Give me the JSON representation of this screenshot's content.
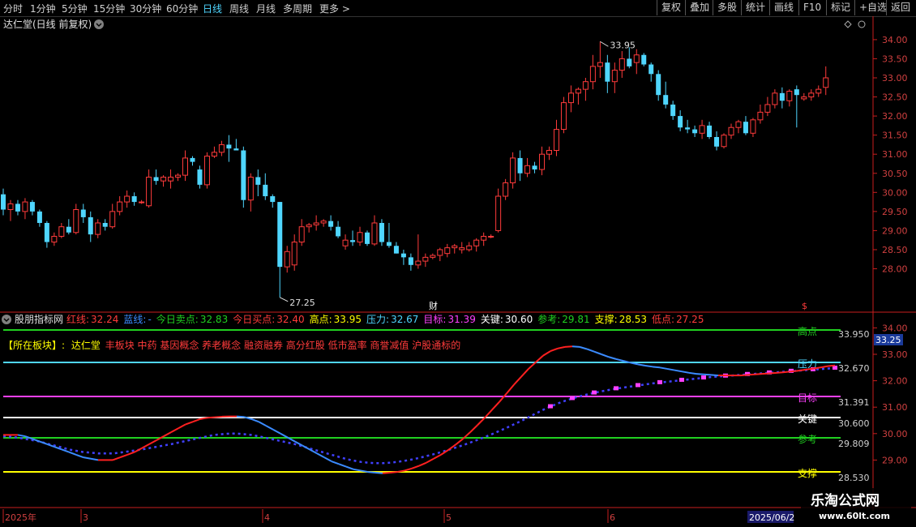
{
  "toolbar": {
    "periods": [
      "分时",
      "1分钟",
      "5分钟",
      "15分钟",
      "30分钟",
      "60分钟",
      "日线",
      "周线",
      "月线",
      "多周期",
      "更多 >"
    ],
    "active_period": "日线",
    "right_buttons": [
      "复权",
      "叠加",
      "多股",
      "统计",
      "画线",
      "F10",
      "标记",
      "+自选",
      "返回"
    ]
  },
  "stock_title": "达仁堂(日线 前复权)",
  "price_axis": [
    "34.00",
    "33.50",
    "33.00",
    "32.50",
    "32.00",
    "31.50",
    "31.00",
    "30.50",
    "30.00",
    "29.50",
    "29.00",
    "28.50",
    "28.00"
  ],
  "high_marker": "33.95",
  "low_marker": "27.25",
  "finance_badge": "财",
  "shares_badge": "$",
  "indicator_name": "股朋指标网",
  "indicator_values": [
    {
      "label": "红线:",
      "value": "32.24",
      "color": "#ff3b3b"
    },
    {
      "label": "蓝线:",
      "value": "-",
      "color": "#3b8bff"
    },
    {
      "label": "今日卖点:",
      "value": "32.83",
      "color": "#20d020"
    },
    {
      "label": "今日买点:",
      "value": "32.40",
      "color": "#ff3b3b"
    },
    {
      "label": "高点:",
      "value": "33.95",
      "color": "#ffff00"
    },
    {
      "label": "压力:",
      "value": "32.67",
      "color": "#4fd6ff"
    },
    {
      "label": "目标:",
      "value": "31.39",
      "color": "#ff40ff"
    },
    {
      "label": "关键:",
      "value": "30.60",
      "color": "#ffffff"
    },
    {
      "label": "参考:",
      "value": "29.81",
      "color": "#20d020"
    },
    {
      "label": "支撑:",
      "value": "28.53",
      "color": "#ffff00"
    },
    {
      "label": "低点:",
      "value": "27.25",
      "color": "#ff3b3b"
    }
  ],
  "sector_label": "【所在板块】:",
  "sector_stock": "达仁堂",
  "sector_tags": "丰板块 中药 基因概念 养老概念 融资融券 高分红股 低市盈率 商誉减值 沪股通标的",
  "indicator_axis": [
    "34.00",
    "33.00",
    "32.00",
    "31.00",
    "30.00",
    "29.00"
  ],
  "level_lines": [
    {
      "name": "高点",
      "value": "33.950",
      "color": "#20d020"
    },
    {
      "name": "压力",
      "value": "32.670",
      "color": "#4fd6ff"
    },
    {
      "name": "目标",
      "value": "31.391",
      "color": "#ff40ff"
    },
    {
      "name": "关键",
      "value": "30.600",
      "color": "#ffffff"
    },
    {
      "name": "参考",
      "value": "29.809",
      "color": "#20d020"
    },
    {
      "name": "支撑",
      "value": "28.530",
      "color": "#ffff00"
    }
  ],
  "current_price_badge": "33.25",
  "date_axis": [
    "2025年",
    "3",
    "4",
    "5",
    "6"
  ],
  "date_cursor": "2025/06/2",
  "watermark": {
    "title": "乐淘公式网",
    "url": "www.60lt.com"
  },
  "colors": {
    "up": "#ff3b3b",
    "down": "#4fd6ff",
    "background": "#000000",
    "axis": "#c81e1e"
  },
  "chart_data": {
    "type": "candlestick",
    "title": "达仁堂(日线 前复权)",
    "candles": [
      [
        29.95,
        30.1,
        29.4,
        29.55
      ],
      [
        29.55,
        29.8,
        29.25,
        29.7
      ],
      [
        29.7,
        29.8,
        29.4,
        29.5
      ],
      [
        29.5,
        29.85,
        29.3,
        29.75
      ],
      [
        29.75,
        29.8,
        29.4,
        29.5
      ],
      [
        29.5,
        29.55,
        29.1,
        29.2
      ],
      [
        29.2,
        29.25,
        28.55,
        28.7
      ],
      [
        28.7,
        28.95,
        28.6,
        28.85
      ],
      [
        28.85,
        29.2,
        28.8,
        29.1
      ],
      [
        29.1,
        29.3,
        28.9,
        28.95
      ],
      [
        28.95,
        29.7,
        28.9,
        29.55
      ],
      [
        29.55,
        29.7,
        29.2,
        29.35
      ],
      [
        29.35,
        29.5,
        28.7,
        28.9
      ],
      [
        28.9,
        29.3,
        28.8,
        29.2
      ],
      [
        29.2,
        29.3,
        29.0,
        29.1
      ],
      [
        29.1,
        29.7,
        29.05,
        29.5
      ],
      [
        29.5,
        29.9,
        29.4,
        29.75
      ],
      [
        29.75,
        30.05,
        29.6,
        29.9
      ],
      [
        29.9,
        30.0,
        29.65,
        29.75
      ],
      [
        29.75,
        29.8,
        29.7,
        29.75
      ],
      [
        29.65,
        30.6,
        29.6,
        30.4
      ],
      [
        30.4,
        30.6,
        30.2,
        30.3
      ],
      [
        30.3,
        30.45,
        30.15,
        30.4
      ],
      [
        30.3,
        30.6,
        30.1,
        30.4
      ],
      [
        30.4,
        30.5,
        30.3,
        30.45
      ],
      [
        30.45,
        31.1,
        30.3,
        30.9
      ],
      [
        30.9,
        30.95,
        30.7,
        30.8
      ],
      [
        30.6,
        30.7,
        30.1,
        30.2
      ],
      [
        30.2,
        31.05,
        30.1,
        30.95
      ],
      [
        30.95,
        31.2,
        30.9,
        31.05
      ],
      [
        31.05,
        31.35,
        30.95,
        31.25
      ],
      [
        31.25,
        31.5,
        30.8,
        31.15
      ],
      [
        31.15,
        31.4,
        31.1,
        31.1
      ],
      [
        31.1,
        31.2,
        29.6,
        29.8
      ],
      [
        29.8,
        30.5,
        29.5,
        30.4
      ],
      [
        30.4,
        30.6,
        29.9,
        30.2
      ],
      [
        30.2,
        30.5,
        29.8,
        29.9
      ],
      [
        29.9,
        29.95,
        29.6,
        29.75
      ],
      [
        29.75,
        29.75,
        27.25,
        28.05
      ],
      [
        28.05,
        28.6,
        27.9,
        28.45
      ],
      [
        28.1,
        28.9,
        27.95,
        28.7
      ],
      [
        28.7,
        29.3,
        28.6,
        29.1
      ],
      [
        29.1,
        29.2,
        28.95,
        29.15
      ],
      [
        29.15,
        29.4,
        29.0,
        29.2
      ],
      [
        29.2,
        29.3,
        29.1,
        29.25
      ],
      [
        29.25,
        29.4,
        29.0,
        29.1
      ],
      [
        29.1,
        29.25,
        28.8,
        28.85
      ],
      [
        28.6,
        28.9,
        28.5,
        28.75
      ],
      [
        28.75,
        29.0,
        28.6,
        28.7
      ],
      [
        28.7,
        29.1,
        28.6,
        28.95
      ],
      [
        28.95,
        29.0,
        28.6,
        28.65
      ],
      [
        28.65,
        29.4,
        28.6,
        29.2
      ],
      [
        29.2,
        29.3,
        28.6,
        28.7
      ],
      [
        28.7,
        29.2,
        28.55,
        28.6
      ],
      [
        28.6,
        28.7,
        28.4,
        28.4
      ],
      [
        28.4,
        28.5,
        28.1,
        28.3
      ],
      [
        28.3,
        28.4,
        27.95,
        28.1
      ],
      [
        28.1,
        28.9,
        28.0,
        28.2
      ],
      [
        28.2,
        28.4,
        28.05,
        28.3
      ],
      [
        28.3,
        28.4,
        28.25,
        28.35
      ],
      [
        28.35,
        28.55,
        28.2,
        28.5
      ],
      [
        28.4,
        28.65,
        28.3,
        28.55
      ],
      [
        28.55,
        28.65,
        28.4,
        28.6
      ],
      [
        28.5,
        28.7,
        28.4,
        28.55
      ],
      [
        28.5,
        28.7,
        28.45,
        28.6
      ],
      [
        28.6,
        28.8,
        28.45,
        28.75
      ],
      [
        28.75,
        28.95,
        28.6,
        28.85
      ],
      [
        28.85,
        28.9,
        28.8,
        28.85
      ],
      [
        29.0,
        30.1,
        28.95,
        29.9
      ],
      [
        29.9,
        30.35,
        29.8,
        30.25
      ],
      [
        30.25,
        31.05,
        30.1,
        30.9
      ],
      [
        30.9,
        31.1,
        30.3,
        30.5
      ],
      [
        30.5,
        30.9,
        30.4,
        30.7
      ],
      [
        30.7,
        30.8,
        30.5,
        30.6
      ],
      [
        30.6,
        31.2,
        30.45,
        31.0
      ],
      [
        31.0,
        31.2,
        30.85,
        31.1
      ],
      [
        31.1,
        31.9,
        30.95,
        31.65
      ],
      [
        31.65,
        32.5,
        31.55,
        32.35
      ],
      [
        32.35,
        32.8,
        32.1,
        32.6
      ],
      [
        32.6,
        32.75,
        32.3,
        32.7
      ],
      [
        32.7,
        33.0,
        32.4,
        32.9
      ],
      [
        32.9,
        33.6,
        32.7,
        33.3
      ],
      [
        33.3,
        33.95,
        33.0,
        33.4
      ],
      [
        33.4,
        33.6,
        32.6,
        32.9
      ],
      [
        32.9,
        33.4,
        32.6,
        33.2
      ],
      [
        33.2,
        33.7,
        33.0,
        33.5
      ],
      [
        33.5,
        33.8,
        33.25,
        33.3
      ],
      [
        33.4,
        33.75,
        33.1,
        33.6
      ],
      [
        33.6,
        33.65,
        33.3,
        33.35
      ],
      [
        33.35,
        33.4,
        32.9,
        33.1
      ],
      [
        33.1,
        33.2,
        32.4,
        32.55
      ],
      [
        32.55,
        32.9,
        32.2,
        32.3
      ],
      [
        32.3,
        32.4,
        31.9,
        32.0
      ],
      [
        32.0,
        32.15,
        31.6,
        31.7
      ],
      [
        31.7,
        31.9,
        31.55,
        31.65
      ],
      [
        31.65,
        31.75,
        31.45,
        31.55
      ],
      [
        31.55,
        31.9,
        31.4,
        31.75
      ],
      [
        31.75,
        31.85,
        31.4,
        31.45
      ],
      [
        31.45,
        31.6,
        31.1,
        31.2
      ],
      [
        31.2,
        31.55,
        31.15,
        31.5
      ],
      [
        31.5,
        31.8,
        31.4,
        31.7
      ],
      [
        31.7,
        31.9,
        31.55,
        31.85
      ],
      [
        31.85,
        32.0,
        31.5,
        31.55
      ],
      [
        31.55,
        31.95,
        31.45,
        31.9
      ],
      [
        31.9,
        32.3,
        31.8,
        32.1
      ],
      [
        32.1,
        32.5,
        32.0,
        32.3
      ],
      [
        32.3,
        32.7,
        32.2,
        32.6
      ],
      [
        32.6,
        32.75,
        32.2,
        32.4
      ],
      [
        32.4,
        32.7,
        32.25,
        32.65
      ],
      [
        32.7,
        32.8,
        31.7,
        32.55
      ],
      [
        32.45,
        32.6,
        32.4,
        32.5
      ],
      [
        32.5,
        32.7,
        32.4,
        32.6
      ],
      [
        32.6,
        32.8,
        32.5,
        32.7
      ],
      [
        32.75,
        33.3,
        32.55,
        33.0
      ]
    ],
    "price_range": [
      27.25,
      33.95
    ],
    "indicator": {
      "type": "line",
      "ylim": [
        28.4,
        34.2
      ],
      "red_line": [
        29.95,
        29.95,
        29.95,
        29.9,
        29.8,
        29.7,
        29.6,
        29.5,
        29.4,
        29.3,
        29.2,
        29.1,
        29.05,
        29.0,
        29.0,
        29.0,
        29.1,
        29.2,
        29.3,
        29.45,
        29.6,
        29.75,
        29.9,
        30.05,
        30.2,
        30.35,
        30.45,
        30.55,
        30.6,
        30.62,
        30.64,
        30.65,
        30.65,
        30.63,
        30.55,
        30.45,
        30.3,
        30.15,
        30.0,
        29.85,
        29.7,
        29.55,
        29.4,
        29.25,
        29.1,
        28.95,
        28.85,
        28.75,
        28.65,
        28.6,
        28.55,
        28.52,
        28.5,
        28.52,
        28.55,
        28.6,
        28.68,
        28.78,
        28.9,
        29.05,
        29.2,
        29.38,
        29.58,
        29.8,
        30.05,
        30.32,
        30.6,
        30.9,
        31.2,
        31.52,
        31.85,
        32.15,
        32.45,
        32.7,
        32.95,
        33.12,
        33.22,
        33.28,
        33.3,
        33.28,
        33.2,
        33.1,
        33.0,
        32.9,
        32.82,
        32.75,
        32.68,
        32.62,
        32.57,
        32.53,
        32.5,
        32.45,
        32.4,
        32.35,
        32.3,
        32.26,
        32.24,
        32.22,
        32.2,
        32.2,
        32.2,
        32.2,
        32.22,
        32.24,
        32.26,
        32.28,
        32.3,
        32.32,
        32.35,
        32.38,
        32.42,
        32.46,
        32.5,
        32.55,
        32.58
      ],
      "blue_line": [
        29.9,
        29.88,
        29.85,
        29.8,
        29.75,
        29.7,
        29.62,
        29.55,
        29.48,
        29.4,
        29.35,
        29.3,
        29.28,
        29.25,
        29.25,
        29.25,
        29.28,
        29.32,
        29.36,
        29.4,
        29.45,
        29.5,
        29.55,
        29.6,
        29.66,
        29.72,
        29.78,
        29.84,
        29.9,
        29.95,
        29.98,
        30.0,
        30.0,
        29.98,
        29.95,
        29.9,
        29.84,
        29.78,
        29.72,
        29.66,
        29.6,
        29.52,
        29.44,
        29.36,
        29.28,
        29.2,
        29.12,
        29.04,
        28.98,
        28.93,
        28.9,
        28.88,
        28.88,
        28.9,
        28.93,
        28.97,
        29.02,
        29.08,
        29.15,
        29.22,
        29.3,
        29.38,
        29.47,
        29.56,
        29.66,
        29.76,
        29.87,
        29.98,
        30.1,
        30.22,
        30.35,
        30.48,
        30.62,
        30.76,
        30.9,
        31.02,
        31.14,
        31.24,
        31.33,
        31.41,
        31.48,
        31.54,
        31.6,
        31.65,
        31.7,
        31.74,
        31.78,
        31.82,
        31.86,
        31.9,
        31.93,
        31.96,
        31.99,
        32.02,
        32.05,
        32.08,
        32.11,
        32.14,
        32.16,
        32.18,
        32.2,
        32.22,
        32.24,
        32.26,
        32.28,
        32.3,
        32.32,
        32.34,
        32.36,
        32.38,
        32.4,
        32.42,
        32.44,
        32.46,
        32.48
      ]
    }
  }
}
